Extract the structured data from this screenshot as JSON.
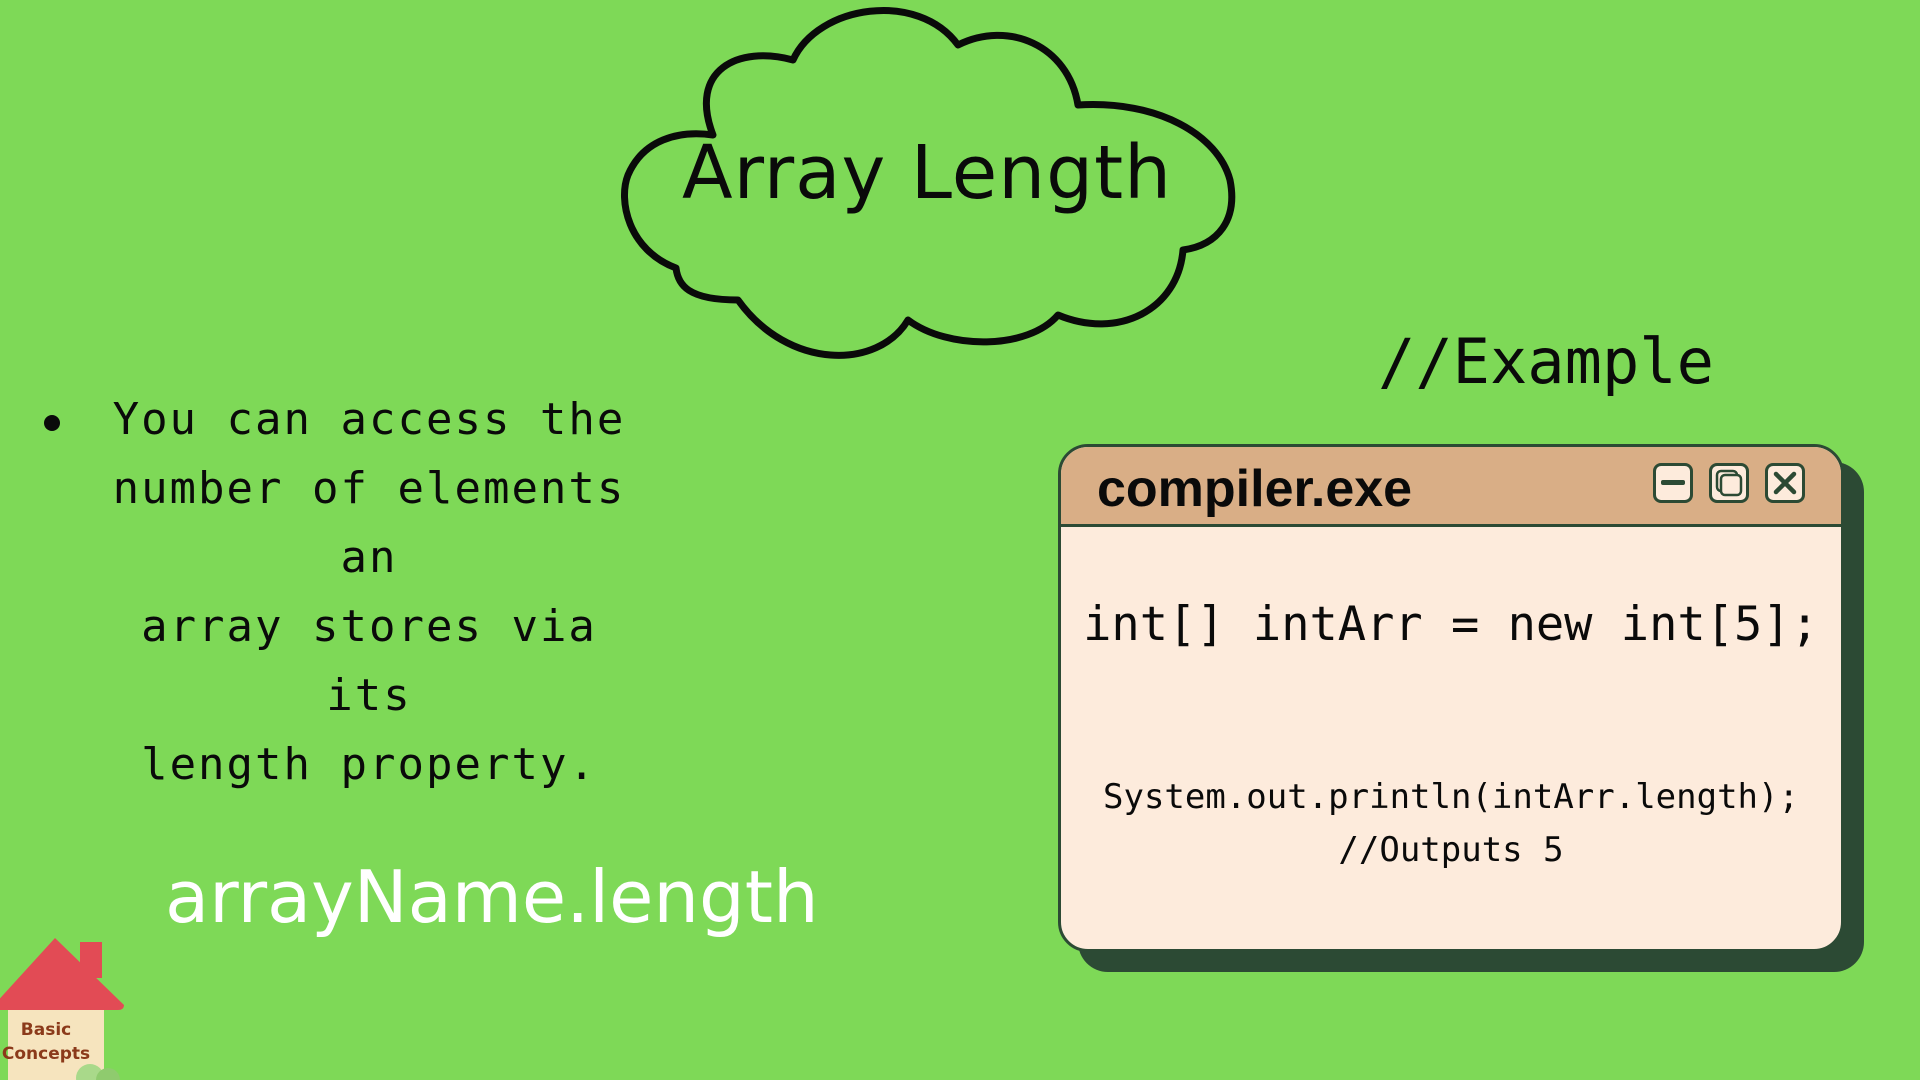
{
  "header": {
    "title": "Array Length"
  },
  "bullet": {
    "text": "You can access the\nnumber of elements an\narray stores via its\nlength property."
  },
  "syntax": {
    "text": "arrayName.length"
  },
  "example": {
    "label": "//Example"
  },
  "window": {
    "title": "compiler.exe",
    "code_line1": "int[] intArr = new int[5];",
    "code_line2": "System.out.println(intArr.length);",
    "code_line3": "//Outputs 5",
    "buttons": [
      "minimize-icon",
      "restore-icon",
      "close-icon"
    ]
  },
  "badge": {
    "line1": "Basic",
    "line2": "Concepts"
  },
  "colors": {
    "background": "#7ED957",
    "window_titlebar": "#D9AE86",
    "window_body": "#FDEBDC",
    "window_shadow": "#2C4A34",
    "syntax_text": "#FFFFFF",
    "badge_roof": "#E24B55",
    "badge_text": "#8B3A1A"
  }
}
